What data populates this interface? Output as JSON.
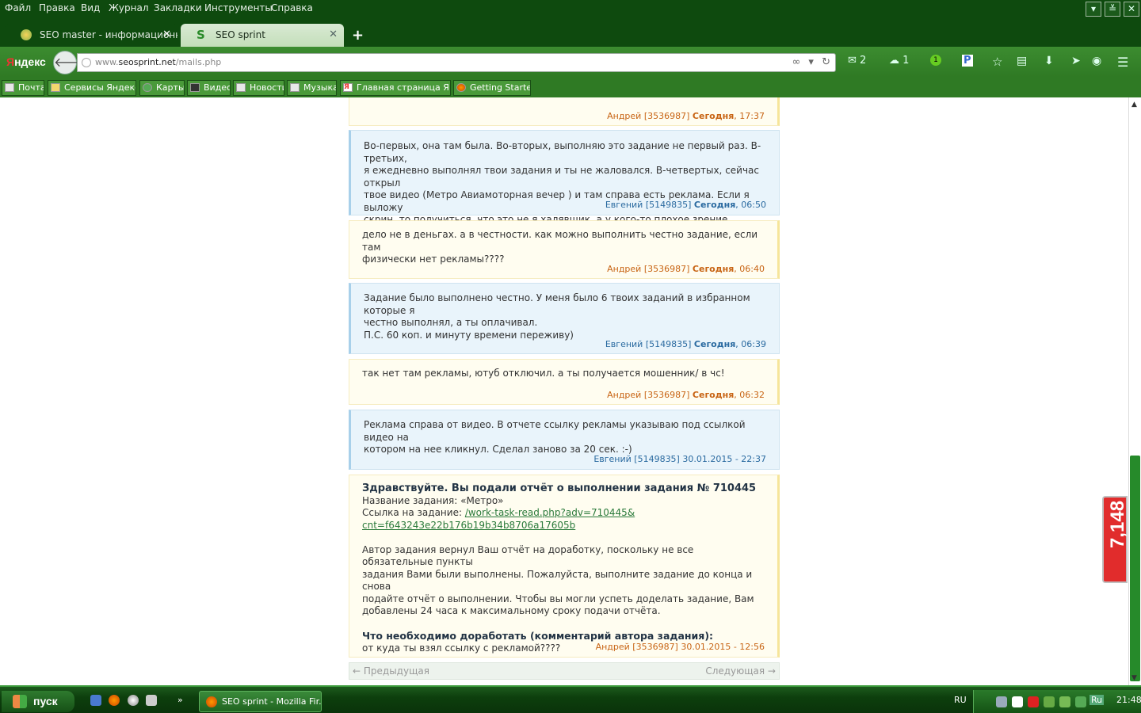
{
  "menu": [
    "Файл",
    "Правка",
    "Вид",
    "Журнал",
    "Закладки",
    "Инструменты",
    "Справка"
  ],
  "tabs": [
    {
      "title": "SEO master - информационн..."
    },
    {
      "title": "SEO sprint"
    }
  ],
  "nav": {
    "logo": "Яндекс",
    "url_prefix": "www.",
    "url_domain": "seosprint.net",
    "url_path": "/mails.php",
    "mail_count": "2",
    "notify_count": "1",
    "badge_count": "1"
  },
  "bookmarks": [
    "Почта",
    "Сервисы Яндекса",
    "Карты",
    "Видео",
    "Новости",
    "Музыка",
    "Главная страница Я...",
    "Getting Started"
  ],
  "messages": [
    {
      "side": "them",
      "author": "Андрей [3536987]",
      "day": "Сегодня",
      "time": ", 17:37",
      "lines": []
    },
    {
      "side": "me",
      "author": "Евгений [5149835]",
      "day": "Сегодня",
      "time": ", 06:50",
      "lines": [
        "Во-первых, она там была. Во-вторых, выполняю это задание не первый раз. В-третьих,",
        "я ежедневно выполнял твои задания и ты не жаловался. В-четвертых, сейчас открыл",
        "твое видео (Метро Авиамоторная вечер ) и там справа есть реклама. Если я выложу",
        "скрин, то получиться, что это не я халявщик, а у кого-то плохое зрение."
      ]
    },
    {
      "side": "them",
      "author": "Андрей [3536987]",
      "day": "Сегодня",
      "time": ", 06:40",
      "lines": [
        "дело не в деньгах. а в честности. как можно выполнить честно задание, если там",
        "физически нет рекламы????"
      ]
    },
    {
      "side": "me",
      "author": "Евгений [5149835]",
      "day": "Сегодня",
      "time": ", 06:39",
      "lines": [
        "Задание было выполнено честно. У меня было 6 твоих заданий в избранном которые я",
        "честно выполнял, а ты оплачивал.",
        "П.С. 60 коп. и минуту времени переживу)"
      ]
    },
    {
      "side": "them",
      "author": "Андрей [3536987]",
      "day": "Сегодня",
      "time": ", 06:32",
      "lines": [
        "так нет там рекламы, ютуб отключил. а ты получается мошенник/ в чс!"
      ]
    },
    {
      "side": "me",
      "author": "Евгений [5149835]",
      "day": "",
      "time": " 30.01.2015 - 22:37",
      "lines": [
        "Реклама справа от видео. В отчете ссылку рекламы указываю под ссылкой видео на",
        "котором на нее кликнул. Сделал заново за 20 сек. :-)"
      ]
    }
  ],
  "system_message": {
    "heading": "Здравствуйте. Вы подали отчёт о выполнении задания № 710445",
    "task_name": "Название задания: «Метро»",
    "link_label": "Ссылка на задание: ",
    "link_1": "/work-task-read.php?adv=710445&",
    "link_2": "cnt=f643243e22b176b19b34b8706a17605b",
    "body": [
      "Автор задания вернул Ваш отчёт на доработку, поскольку не все обязательные пункты",
      "задания Вами были выполнены. Пожалуйста, выполните задание до конца и снова",
      "подайте отчёт о выполнении. Чтобы вы могли успеть доделать задание, Вам",
      "добавлены 24 часа к максимальному сроку подачи отчёта."
    ],
    "comment_heading": "Что необходимо доработать (комментарий автора задания):",
    "comment": "от куда ты взял ссылку с рекламой????",
    "author": "Андрей [3536987] 30.01.2015 - 12:56"
  },
  "pager": {
    "prev": "← Предыдущая",
    "next": "Следующая →"
  },
  "side_widget": "7,148",
  "taskbar": {
    "start": "пуск",
    "window": "SEO sprint - Mozilla Fir...",
    "lang": "RU",
    "lang2": "Ru",
    "clock": "21:48"
  }
}
